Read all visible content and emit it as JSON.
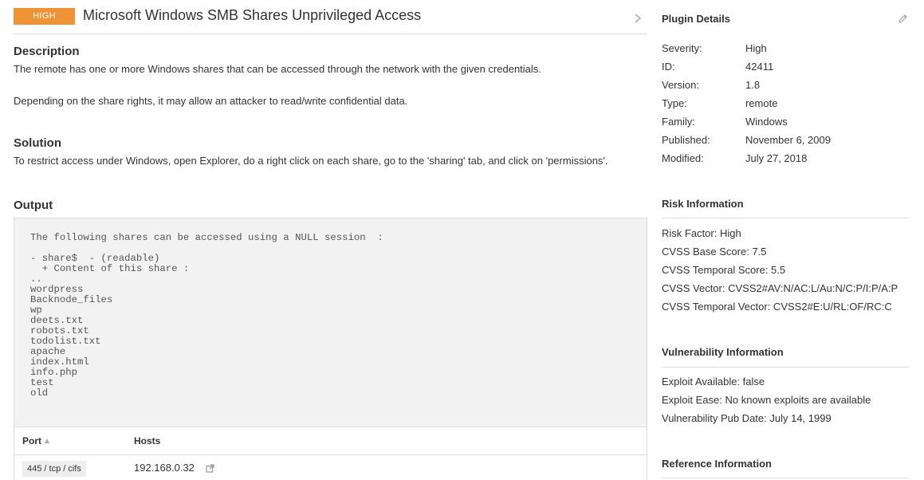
{
  "header": {
    "severity_badge": "HIGH",
    "title": "Microsoft Windows SMB Shares Unprivileged Access"
  },
  "description": {
    "heading": "Description",
    "line1": "The remote has one or more Windows shares that can be accessed through the network with the given credentials.",
    "line2": "Depending on the share rights, it may allow an attacker to read/write confidential data."
  },
  "solution": {
    "heading": "Solution",
    "text": "To restrict access under Windows, open Explorer, do a right click on each share, go to the 'sharing' tab, and click on 'permissions'."
  },
  "output": {
    "heading": "Output",
    "text": "The following shares can be accessed using a NULL session  :\n\n- share$  - (readable)\n  + Content of this share :\n..\nwordpress\nBacknode_files\nwp\ndeets.txt\nrobots.txt\ntodolist.txt\napache\nindex.html\ninfo.php\ntest\nold"
  },
  "ports_table": {
    "col_port": "Port",
    "col_hosts": "Hosts",
    "rows": [
      {
        "port": "445 / tcp / cifs",
        "host": "192.168.0.32"
      }
    ]
  },
  "plugin_details": {
    "heading": "Plugin Details",
    "rows": [
      {
        "key": "Severity:",
        "value": "High"
      },
      {
        "key": "ID:",
        "value": "42411"
      },
      {
        "key": "Version:",
        "value": "1.8"
      },
      {
        "key": "Type:",
        "value": "remote"
      },
      {
        "key": "Family:",
        "value": "Windows"
      },
      {
        "key": "Published:",
        "value": "November 6, 2009"
      },
      {
        "key": "Modified:",
        "value": "July 27, 2018"
      }
    ]
  },
  "risk_info": {
    "heading": "Risk Information",
    "lines": [
      "Risk Factor: High",
      "CVSS Base Score: 7.5",
      "CVSS Temporal Score: 5.5",
      "CVSS Vector: CVSS2#AV:N/AC:L/Au:N/C:P/I:P/A:P",
      "CVSS Temporal Vector: CVSS2#E:U/RL:OF/RC:C"
    ]
  },
  "vuln_info": {
    "heading": "Vulnerability Information",
    "lines": [
      "Exploit Available: false",
      "Exploit Ease: No known exploits are available",
      "Vulnerability Pub Date: July 14, 1999"
    ]
  },
  "reference_info": {
    "heading": "Reference Information"
  },
  "colors": {
    "severity_high": "#ee9336",
    "output_bg": "#f2f2f2",
    "divider": "#dddddd"
  },
  "icons": {
    "title_right": "chevron-right-icon",
    "edit": "pencil-icon",
    "host_link": "external-link-icon",
    "sort": "sort-up-icon"
  }
}
